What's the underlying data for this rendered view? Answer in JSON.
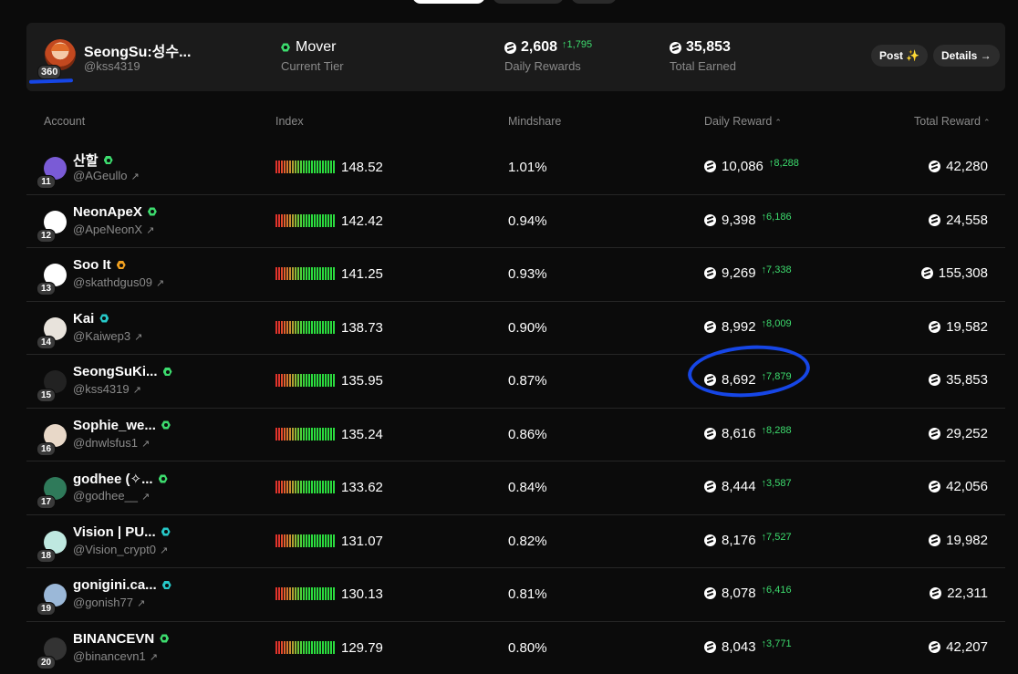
{
  "colors": {
    "accent_green": "#3ddc6e",
    "hex_green": "#3ddc6e",
    "hex_teal": "#27c9c9",
    "hex_orange": "#f0a020",
    "annotation_blue": "#1646e6"
  },
  "user_card": {
    "rank": "360",
    "name": "SeongSu:성수...",
    "handle": "@kss4319",
    "tier": "Mover",
    "tier_label": "Current Tier",
    "daily_rewards": "2,608",
    "daily_delta": "↑1,795",
    "daily_label": "Daily Rewards",
    "total_earned": "35,853",
    "total_label": "Total Earned",
    "post_label": "Post ✨",
    "details_label": "Details →"
  },
  "table": {
    "headers": {
      "account": "Account",
      "index": "Index",
      "mindshare": "Mindshare",
      "daily": "Daily Reward",
      "total": "Total Reward"
    },
    "rows": [
      {
        "rank": "11",
        "name": "산할",
        "handle": "@AGeullo",
        "badge": "green",
        "index": "148.52",
        "mindshare": "1.01%",
        "daily": "10,086",
        "delta": "↑8,288",
        "total": "42,280"
      },
      {
        "rank": "12",
        "name": "NeonApeX",
        "handle": "@ApeNeonX",
        "badge": "green",
        "index": "142.42",
        "mindshare": "0.94%",
        "daily": "9,398",
        "delta": "↑6,186",
        "total": "24,558"
      },
      {
        "rank": "13",
        "name": "Soo It",
        "handle": "@skathdgus09",
        "badge": "orange",
        "index": "141.25",
        "mindshare": "0.93%",
        "daily": "9,269",
        "delta": "↑7,338",
        "total": "155,308"
      },
      {
        "rank": "14",
        "name": "Kai",
        "handle": "@Kaiwep3",
        "badge": "teal",
        "index": "138.73",
        "mindshare": "0.90%",
        "daily": "8,992",
        "delta": "↑8,009",
        "total": "19,582"
      },
      {
        "rank": "15",
        "name": "SeongSuKi...",
        "handle": "@kss4319",
        "badge": "green",
        "index": "135.95",
        "mindshare": "0.87%",
        "daily": "8,692",
        "delta": "↑7,879",
        "total": "35,853"
      },
      {
        "rank": "16",
        "name": "Sophie_we...",
        "handle": "@dnwlsfus1",
        "badge": "green",
        "index": "135.24",
        "mindshare": "0.86%",
        "daily": "8,616",
        "delta": "↑8,288",
        "total": "29,252"
      },
      {
        "rank": "17",
        "name": "godhee (✧...",
        "handle": "@godhee__",
        "badge": "green",
        "index": "133.62",
        "mindshare": "0.84%",
        "daily": "8,444",
        "delta": "↑3,587",
        "total": "42,056"
      },
      {
        "rank": "18",
        "name": "Vision | PU...",
        "handle": "@Vision_crypt0",
        "badge": "teal",
        "index": "131.07",
        "mindshare": "0.82%",
        "daily": "8,176",
        "delta": "↑7,527",
        "total": "19,982"
      },
      {
        "rank": "19",
        "name": "gonigini.ca...",
        "handle": "@gonish77",
        "badge": "teal",
        "index": "130.13",
        "mindshare": "0.81%",
        "daily": "8,078",
        "delta": "↑6,416",
        "total": "22,311"
      },
      {
        "rank": "20",
        "name": "BINANCEVN",
        "handle": "@binancevn1",
        "badge": "green",
        "index": "129.79",
        "mindshare": "0.80%",
        "daily": "8,043",
        "delta": "↑3,771",
        "total": "42,207"
      }
    ]
  }
}
